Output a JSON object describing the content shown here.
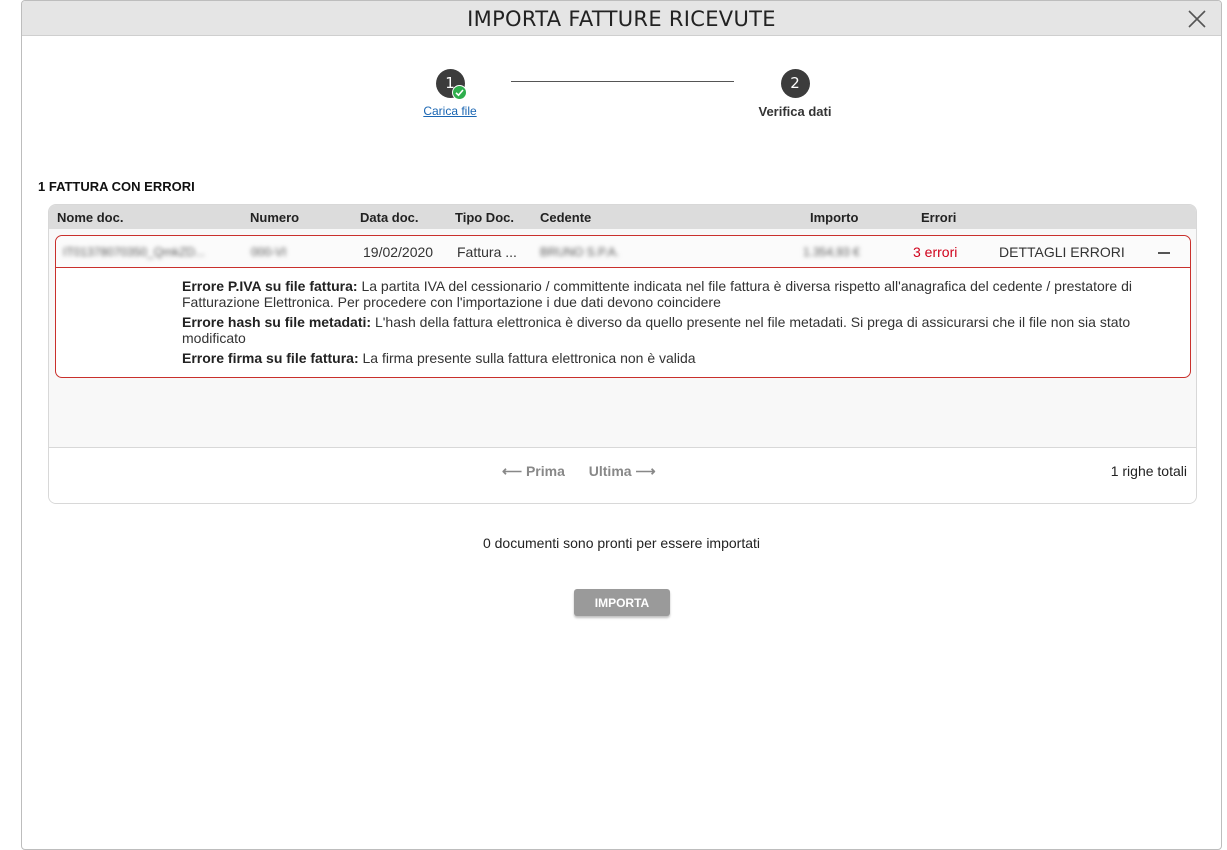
{
  "modal": {
    "title": "IMPORTA FATTURE RICEVUTE",
    "close_icon": "close-icon"
  },
  "stepper": {
    "steps": [
      {
        "number": "1",
        "label": "Carica file",
        "completed": true
      },
      {
        "number": "2",
        "label": "Verifica dati",
        "completed": false
      }
    ]
  },
  "section": {
    "title": "1 FATTURA CON ERRORI"
  },
  "table": {
    "columns": [
      "Nome doc.",
      "Numero",
      "Data doc.",
      "Tipo Doc.",
      "Cedente",
      "Importo",
      "Errori"
    ],
    "rows": [
      {
        "nome_doc": "IT01378070350_QmkZD...",
        "numero": "000-VI",
        "data_doc": "19/02/2020",
        "tipo_doc": "Fattura ...",
        "cedente": "BRUNO S.P.A.",
        "importo": "1.354,93 €",
        "errori": "3 errori",
        "action": "DETTAGLI ERRORI",
        "errors": [
          {
            "title": "Errore P.IVA su file fattura:",
            "text": "La partita IVA del cessionario / committente indicata nel file fattura è diversa rispetto all'anagrafica del cedente / prestatore di Fatturazione Elettronica. Per procedere con l'importazione i due dati devono coincidere"
          },
          {
            "title": "Errore hash su file metadati:",
            "text": "L'hash della fattura elettronica è diverso da quello presente nel file metadati. Si prega di assicurarsi che il file non sia stato modificato"
          },
          {
            "title": "Errore firma su file fattura:",
            "text": "La firma presente sulla fattura elettronica non è valida"
          }
        ]
      }
    ],
    "pager": {
      "first": "⟵ Prima",
      "last": "Ultima ⟶"
    },
    "total": "1 righe totali"
  },
  "summary": {
    "ready_text": "0 documenti sono pronti per essere importati",
    "import_button": "IMPORTA"
  },
  "colors": {
    "error": "#d0021b",
    "success": "#2eae4c",
    "link": "#1a66b3"
  }
}
